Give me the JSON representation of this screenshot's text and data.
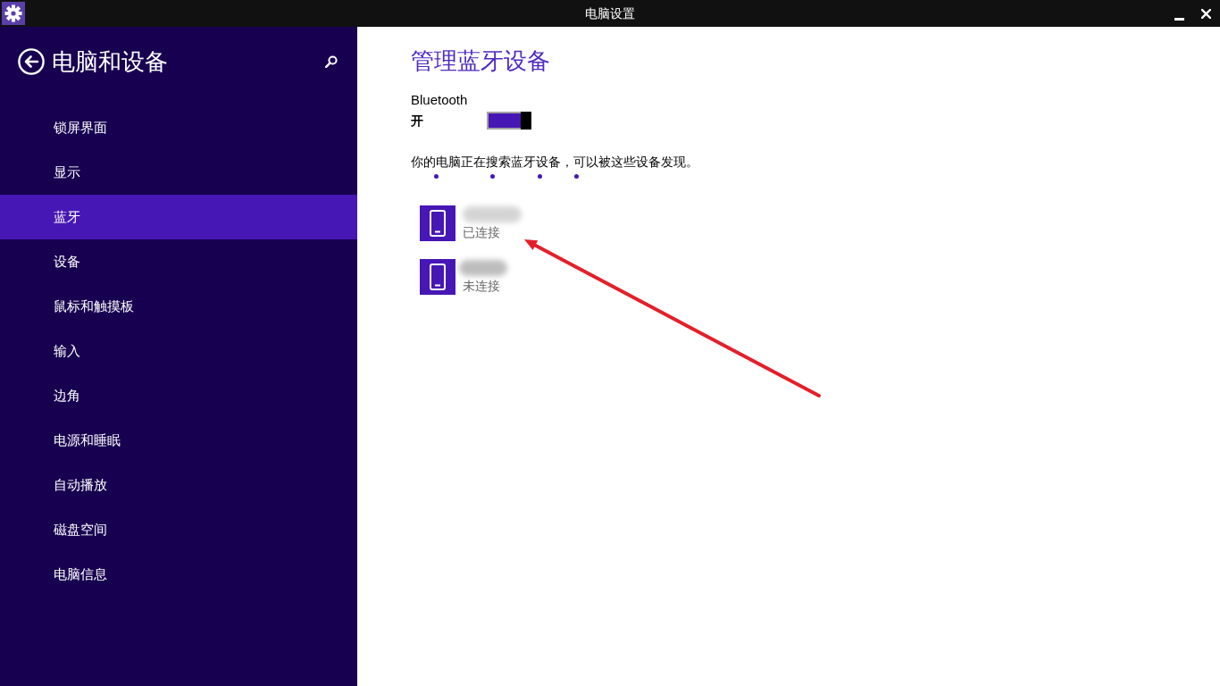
{
  "window": {
    "title": "电脑设置"
  },
  "sidebar": {
    "title": "电脑和设备",
    "items": [
      {
        "label": "锁屏界面",
        "selected": false
      },
      {
        "label": "显示",
        "selected": false
      },
      {
        "label": "蓝牙",
        "selected": true
      },
      {
        "label": "设备",
        "selected": false
      },
      {
        "label": "鼠标和触摸板",
        "selected": false
      },
      {
        "label": "输入",
        "selected": false
      },
      {
        "label": "边角",
        "selected": false
      },
      {
        "label": "电源和睡眠",
        "selected": false
      },
      {
        "label": "自动播放",
        "selected": false
      },
      {
        "label": "磁盘空间",
        "selected": false
      },
      {
        "label": "电脑信息",
        "selected": false
      }
    ]
  },
  "content": {
    "heading": "管理蓝牙设备",
    "bluetooth": {
      "label": "Bluetooth",
      "state_label": "开",
      "on": true
    },
    "status_text": "你的电脑正在搜索蓝牙设备，可以被这些设备发现。",
    "searching": true,
    "devices": [
      {
        "status": "已连接"
      },
      {
        "status": "未连接"
      }
    ]
  }
}
